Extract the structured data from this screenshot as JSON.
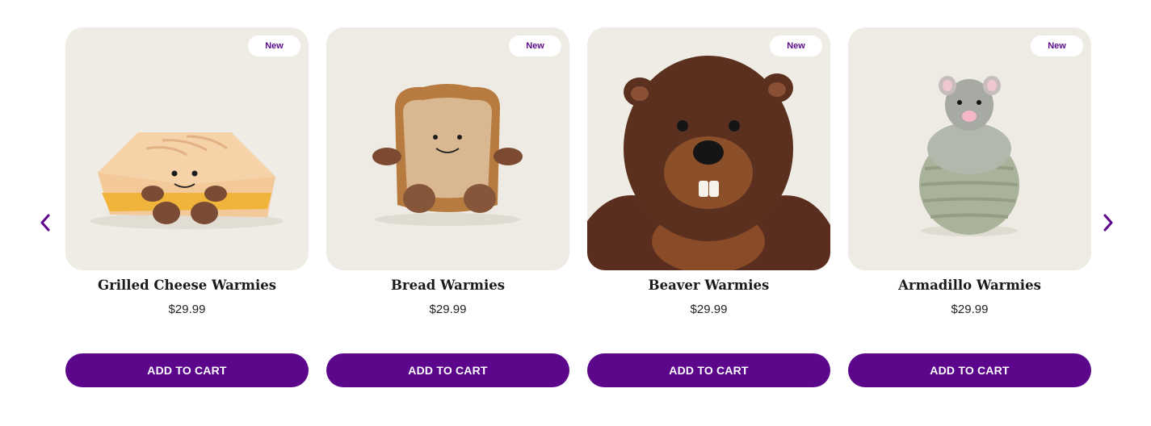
{
  "carousel": {
    "prev_icon": "chevron-left-icon",
    "next_icon": "chevron-right-icon",
    "accent_color": "#5c068c"
  },
  "products": [
    {
      "name": "Grilled Cheese Warmies",
      "price": "$29.99",
      "badge": "New",
      "button": "ADD TO CART"
    },
    {
      "name": "Bread Warmies",
      "price": "$29.99",
      "badge": "New",
      "button": "ADD TO CART"
    },
    {
      "name": "Beaver Warmies",
      "price": "$29.99",
      "badge": "New",
      "button": "ADD TO CART"
    },
    {
      "name": "Armadillo Warmies",
      "price": "$29.99",
      "badge": "New",
      "button": "ADD TO CART"
    }
  ]
}
